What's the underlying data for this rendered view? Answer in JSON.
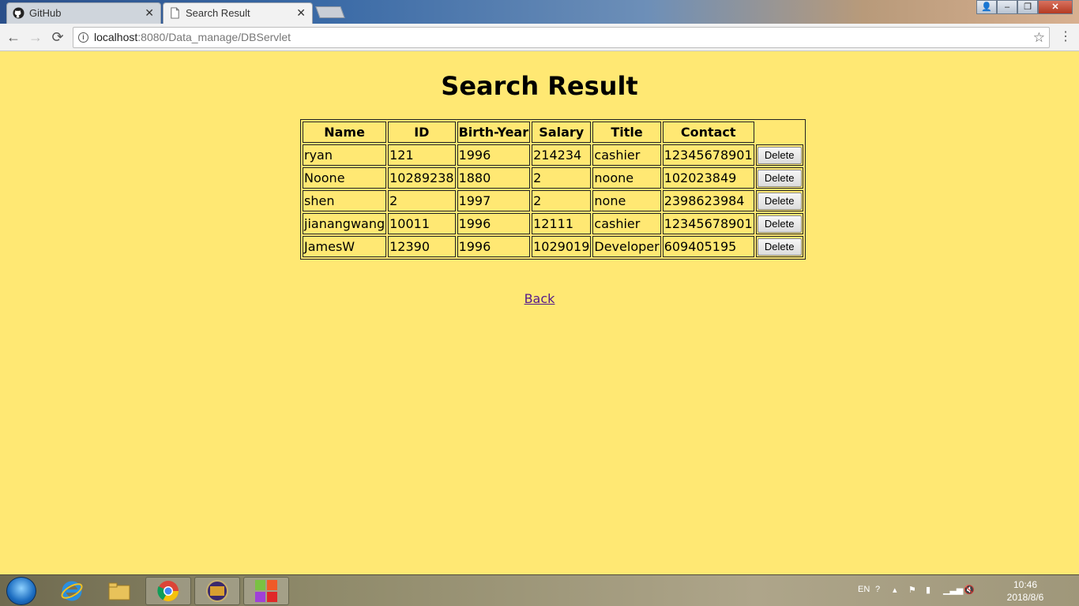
{
  "browser": {
    "tabs": [
      {
        "label": "GitHub",
        "active": false
      },
      {
        "label": "Search Result",
        "active": true
      }
    ],
    "url_host": "localhost",
    "url_rest": ":8080/Data_manage/DBServlet"
  },
  "page": {
    "title": "Search Result",
    "table": {
      "headers": [
        "Name",
        "ID",
        "Birth-Year",
        "Salary",
        "Title",
        "Contact"
      ],
      "rows": [
        [
          "ryan",
          "121",
          "1996",
          "214234",
          "cashier",
          "12345678901"
        ],
        [
          "Noone",
          "10289238",
          "1880",
          "2",
          "noone",
          "102023849"
        ],
        [
          "shen",
          "2",
          "1997",
          "2",
          "none",
          "2398623984"
        ],
        [
          "jianangwang",
          "10011",
          "1996",
          "12111",
          "cashier",
          "12345678901"
        ],
        [
          "JamesW",
          "12390",
          "1996",
          "1029019",
          "Developer",
          "609405195"
        ]
      ],
      "action_label": "Delete"
    },
    "back_label": "Back"
  },
  "taskbar": {
    "pinned": [
      "ie-icon",
      "explorer-icon",
      "chrome-icon",
      "eclipse-icon",
      "tiles-icon"
    ],
    "tray_lang": "EN",
    "clock_time": "10:46",
    "clock_date": "2018/8/6"
  },
  "colors": {
    "page_bg": "#ffe873",
    "link": "#551a8b"
  }
}
